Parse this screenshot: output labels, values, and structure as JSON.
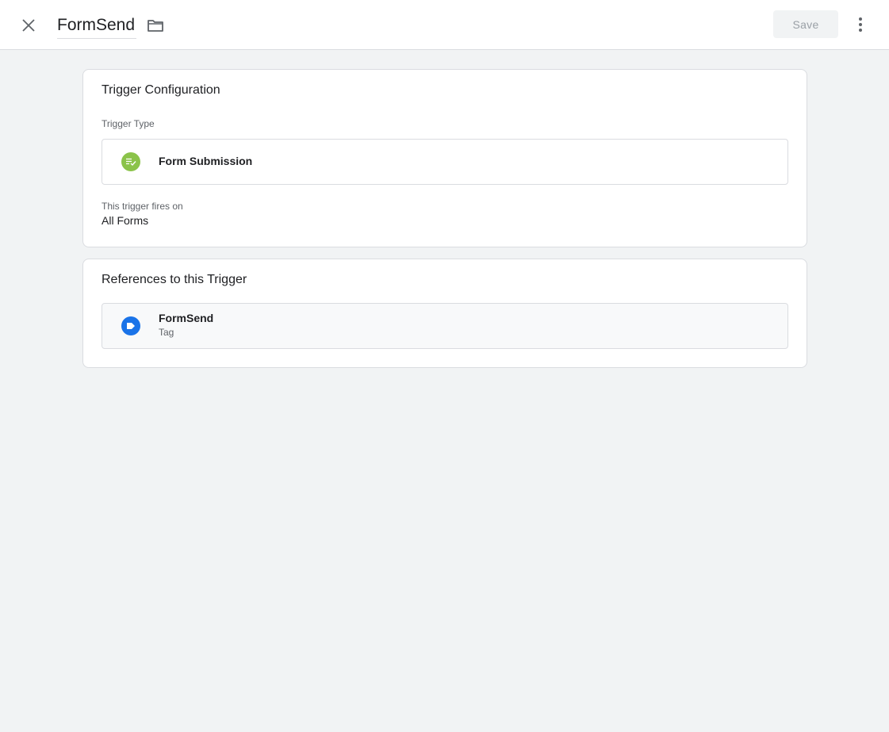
{
  "header": {
    "title": "FormSend",
    "save_label": "Save",
    "icons": {
      "close": "close-icon",
      "folder": "folder-icon",
      "more": "more-vert-icon"
    }
  },
  "trigger_config": {
    "card_title": "Trigger Configuration",
    "type_label": "Trigger Type",
    "type_value": "Form Submission",
    "type_icon": "form-submission-icon",
    "type_icon_color": "#8bc34a",
    "fires_label": "This trigger fires on",
    "fires_value": "All Forms"
  },
  "references": {
    "card_title": "References to this Trigger",
    "items": [
      {
        "name": "FormSend",
        "type": "Tag",
        "icon": "tag-icon",
        "icon_color": "#1a73e8"
      }
    ]
  },
  "colors": {
    "background": "#f1f3f4",
    "card": "#ffffff",
    "border": "#dadce0",
    "save_disabled_text": "#9aa0a6"
  }
}
